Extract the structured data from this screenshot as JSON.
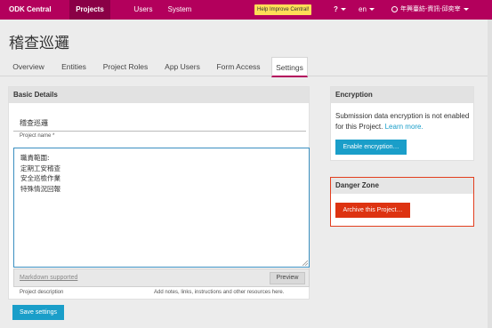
{
  "navbar": {
    "brand": "ODK Central",
    "items": [
      "Projects",
      "Users",
      "System"
    ],
    "improve": "Help Improve Central!",
    "help": "?",
    "language": "en",
    "user": "年興臺紡-資訊-邱奕宰"
  },
  "page": {
    "title": "稽查巡邏",
    "tabs": [
      "Overview",
      "Entities",
      "Project Roles",
      "App Users",
      "Form Access",
      "Settings"
    ],
    "active_tab": "Settings"
  },
  "basic_details": {
    "header": "Basic Details",
    "project_name": "稽查巡邏",
    "project_name_label": "Project name *",
    "description_lines": [
      "職責範圍:",
      "定期工安稽查",
      "安全巡檢作業",
      "特殊情況回報"
    ],
    "markdown_link": "Markdown supported",
    "preview_button": "Preview",
    "description_label": "Project description",
    "description_hint": "Add notes, links, instructions and other resources here."
  },
  "save_button": "Save settings",
  "encryption": {
    "header": "Encryption",
    "text": "Submission data encryption is not enabled for this Project.",
    "learn_more": "Learn more.",
    "button": "Enable encryption…"
  },
  "danger_zone": {
    "header": "Danger Zone",
    "button": "Archive this Project…"
  },
  "colors": {
    "brand": "#b3005c",
    "accent": "#1a9ec9",
    "danger": "#dd3311"
  }
}
